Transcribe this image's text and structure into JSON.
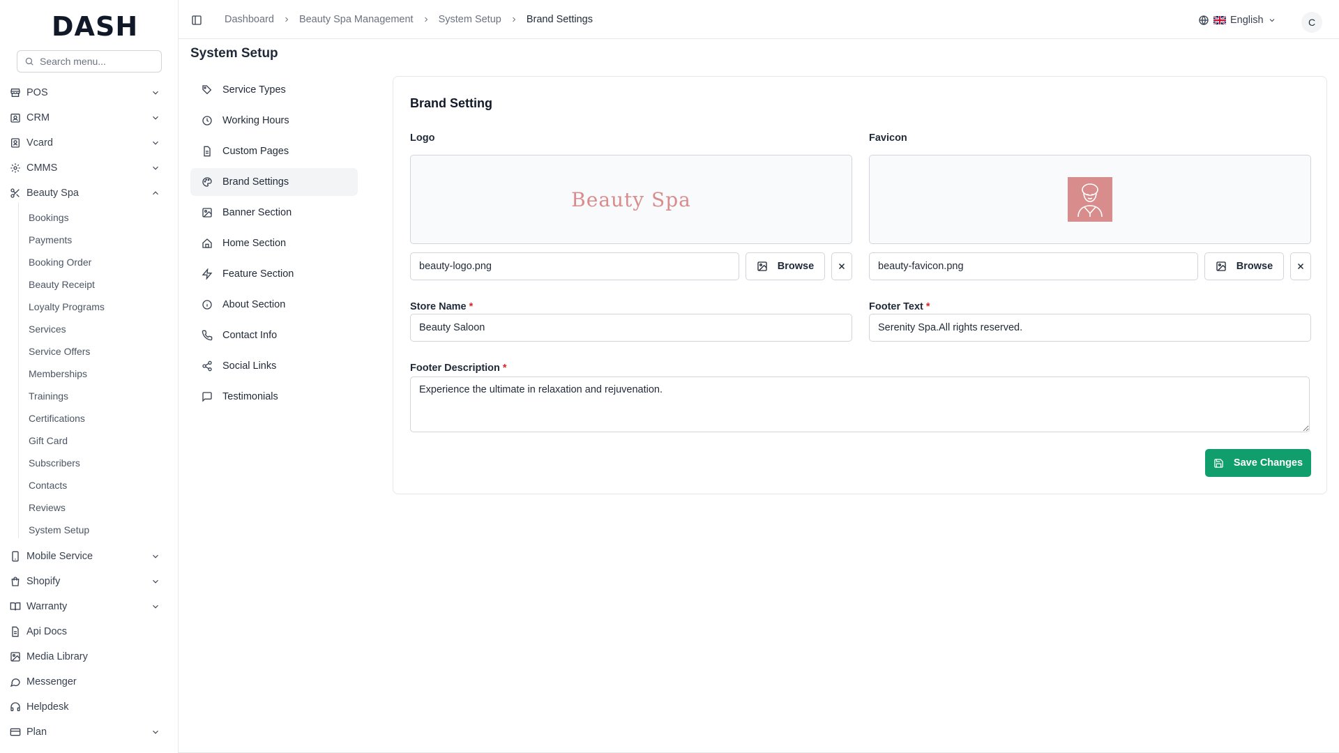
{
  "app": {
    "logo_text": "DASH"
  },
  "search": {
    "placeholder": "Search menu..."
  },
  "sidebar": {
    "items": [
      {
        "label": "POS",
        "icon": "store-icon",
        "expandable": true
      },
      {
        "label": "CRM",
        "icon": "contact-card-icon",
        "expandable": true
      },
      {
        "label": "Vcard",
        "icon": "id-badge-icon",
        "expandable": true
      },
      {
        "label": "CMMS",
        "icon": "gear-icon",
        "expandable": true
      },
      {
        "label": "Beauty Spa",
        "icon": "scissors-icon",
        "expandable": true,
        "expanded": true
      },
      {
        "label": "Mobile Service",
        "icon": "smartphone-icon",
        "expandable": true
      },
      {
        "label": "Shopify",
        "icon": "shopping-bag-icon",
        "expandable": true
      },
      {
        "label": "Warranty",
        "icon": "book-open-icon",
        "expandable": true
      },
      {
        "label": "Api Docs",
        "icon": "document-icon",
        "expandable": false
      },
      {
        "label": "Media Library",
        "icon": "image-icon",
        "expandable": false
      },
      {
        "label": "Messenger",
        "icon": "chat-bubble-icon",
        "expandable": false
      },
      {
        "label": "Helpdesk",
        "icon": "headset-icon",
        "expandable": false
      },
      {
        "label": "Plan",
        "icon": "credit-card-icon",
        "expandable": true
      }
    ],
    "beauty_spa_children": [
      "Bookings",
      "Payments",
      "Booking Order",
      "Beauty Receipt",
      "Loyalty Programs",
      "Services",
      "Service Offers",
      "Memberships",
      "Trainings",
      "Certifications",
      "Gift Card",
      "Subscribers",
      "Contacts",
      "Reviews",
      "System Setup"
    ]
  },
  "header": {
    "breadcrumbs": [
      "Dashboard",
      "Beauty Spa Management",
      "System Setup",
      "Brand Settings"
    ],
    "language": "English",
    "avatar_initial": "C"
  },
  "page": {
    "title": "System Setup"
  },
  "setup_menu": [
    {
      "label": "Service Types",
      "icon": "tag-icon"
    },
    {
      "label": "Working Hours",
      "icon": "clock-icon"
    },
    {
      "label": "Custom Pages",
      "icon": "file-text-icon"
    },
    {
      "label": "Brand Settings",
      "icon": "palette-icon",
      "active": true
    },
    {
      "label": "Banner Section",
      "icon": "image-icon"
    },
    {
      "label": "Home Section",
      "icon": "home-icon"
    },
    {
      "label": "Feature Section",
      "icon": "zap-icon"
    },
    {
      "label": "About Section",
      "icon": "info-icon"
    },
    {
      "label": "Contact Info",
      "icon": "phone-icon"
    },
    {
      "label": "Social Links",
      "icon": "share-icon"
    },
    {
      "label": "Testimonials",
      "icon": "message-square-icon"
    }
  ],
  "brand": {
    "card_title": "Brand Setting",
    "logo": {
      "label": "Logo",
      "preview_text": "Beauty Spa",
      "file_name": "beauty-logo.png",
      "browse_label": "Browse"
    },
    "favicon": {
      "label": "Favicon",
      "file_name": "beauty-favicon.png",
      "browse_label": "Browse"
    },
    "store_name": {
      "label": "Store Name",
      "value": "Beauty Saloon",
      "required": true
    },
    "footer_text": {
      "label": "Footer Text",
      "value": "Serenity Spa.All rights reserved.",
      "required": true
    },
    "footer_description": {
      "label": "Footer Description",
      "value": "Experience the ultimate in relaxation and rejuvenation.",
      "required": true
    },
    "save_label": "Save Changes"
  },
  "colors": {
    "accent": "#109e6c",
    "brand_pink": "#d98c8c",
    "required": "#dc2626"
  }
}
